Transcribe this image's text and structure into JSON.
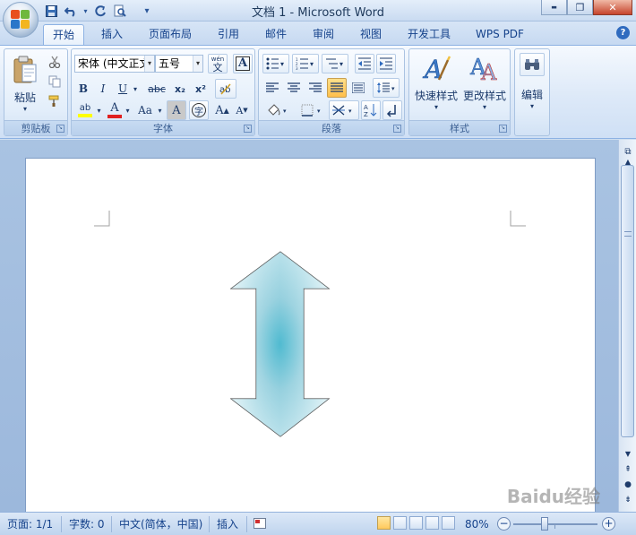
{
  "window": {
    "title": "文档 1 - Microsoft Word",
    "minimize_glyph": "▬",
    "restore_glyph": "❐",
    "close_glyph": "✕"
  },
  "quick_access": {
    "save_icon": "save-icon",
    "undo_icon": "undo-icon",
    "redo_icon": "redo-icon",
    "print_preview_icon": "print-preview-icon",
    "customize_glyph": "▾"
  },
  "tabs": [
    {
      "label": "开始",
      "active": true
    },
    {
      "label": "插入"
    },
    {
      "label": "页面布局"
    },
    {
      "label": "引用"
    },
    {
      "label": "邮件"
    },
    {
      "label": "审阅"
    },
    {
      "label": "视图"
    },
    {
      "label": "开发工具"
    },
    {
      "label": "WPS PDF"
    }
  ],
  "help_label": "?",
  "ribbon": {
    "clipboard": {
      "paste_label": "粘贴",
      "group_label": "剪贴板"
    },
    "font": {
      "font_name": "宋体 (中文正文",
      "font_size": "五号",
      "bold": "B",
      "italic": "I",
      "underline": "U",
      "strike": "abc",
      "subscript": "x₂",
      "superscript": "x²",
      "font_color": "A",
      "change_case": "Aa",
      "char_shading": "A",
      "enclose": "字",
      "grow": "A",
      "shrink": "A",
      "phonetic": "wén",
      "phonetic_char": "文",
      "highlight": "ab",
      "group_label": "字体"
    },
    "paragraph": {
      "group_label": "段落"
    },
    "styles": {
      "quick_styles_label": "快速样式",
      "change_styles_label": "更改样式",
      "group_label": "样式"
    },
    "editing": {
      "label": "编辑"
    }
  },
  "statusbar": {
    "page": "页面: 1/1",
    "words": "字数: 0",
    "language": "中文(简体，中国)",
    "mode": "插入",
    "zoom": "80%",
    "zoom_minus": "−",
    "zoom_plus": "+"
  },
  "document": {
    "shape": "up-down-arrow",
    "shape_fill": "#bde3ec",
    "shape_fill_center": "#3cb4cc"
  },
  "watermark": "Baidu经验",
  "colors": {
    "accent": "#15428b",
    "ribbon_border": "#8db2e3",
    "font_color_bar": "#e02020",
    "highlight_bar": "#ffff00"
  }
}
